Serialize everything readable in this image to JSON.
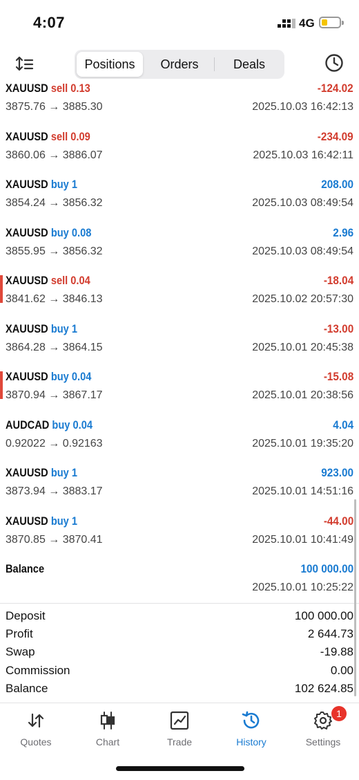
{
  "status_bar": {
    "time": "4:07",
    "network": "4G"
  },
  "header": {
    "tabs": [
      {
        "label": "Positions",
        "active": true
      },
      {
        "label": "Orders",
        "active": false
      },
      {
        "label": "Deals",
        "active": false
      }
    ]
  },
  "deals": [
    {
      "symbol": "XAUUSD",
      "side": "sell",
      "volume": "0.13",
      "prices": "3875.76 → 3885.30",
      "profit": "-124.02",
      "date": "2025.10.03 16:42:13",
      "accent": false
    },
    {
      "symbol": "XAUUSD",
      "side": "sell",
      "volume": "0.09",
      "prices": "3860.06 → 3886.07",
      "profit": "-234.09",
      "date": "2025.10.03 16:42:11",
      "accent": false
    },
    {
      "symbol": "XAUUSD",
      "side": "buy",
      "volume": "1",
      "prices": "3854.24 → 3856.32",
      "profit": "208.00",
      "date": "2025.10.03 08:49:54",
      "accent": false
    },
    {
      "symbol": "XAUUSD",
      "side": "buy",
      "volume": "0.08",
      "prices": "3855.95 → 3856.32",
      "profit": "2.96",
      "date": "2025.10.03 08:49:54",
      "accent": false
    },
    {
      "symbol": "XAUUSD",
      "side": "sell",
      "volume": "0.04",
      "prices": "3841.62 → 3846.13",
      "profit": "-18.04",
      "date": "2025.10.02 20:57:30",
      "accent": true
    },
    {
      "symbol": "XAUUSD",
      "side": "buy",
      "volume": "1",
      "prices": "3864.28 → 3864.15",
      "profit": "-13.00",
      "date": "2025.10.01 20:45:38",
      "accent": false
    },
    {
      "symbol": "XAUUSD",
      "side": "buy",
      "volume": "0.04",
      "prices": "3870.94 → 3867.17",
      "profit": "-15.08",
      "date": "2025.10.01 20:38:56",
      "accent": true
    },
    {
      "symbol": "AUDCAD",
      "side": "buy",
      "volume": "0.04",
      "prices": "0.92022 → 0.92163",
      "profit": "4.04",
      "date": "2025.10.01 19:35:20",
      "accent": false
    },
    {
      "symbol": "XAUUSD",
      "side": "buy",
      "volume": "1",
      "prices": "3873.94 → 3883.17",
      "profit": "923.00",
      "date": "2025.10.01 14:51:16",
      "accent": false
    },
    {
      "symbol": "XAUUSD",
      "side": "buy",
      "volume": "1",
      "prices": "3870.85 → 3870.41",
      "profit": "-44.00",
      "date": "2025.10.01 10:41:49",
      "accent": false
    },
    {
      "symbol": "Balance",
      "side": "",
      "volume": "",
      "prices": "",
      "profit": "100 000.00",
      "date": "2025.10.01 10:25:22",
      "accent": false
    }
  ],
  "summary": [
    {
      "label": "Deposit",
      "value": "100 000.00"
    },
    {
      "label": "Profit",
      "value": "2 644.73"
    },
    {
      "label": "Swap",
      "value": "-19.88"
    },
    {
      "label": "Commission",
      "value": "0.00"
    },
    {
      "label": "Balance",
      "value": "102 624.85"
    }
  ],
  "nav": {
    "items": [
      {
        "label": "Quotes",
        "icon": "arrows-updown-icon"
      },
      {
        "label": "Chart",
        "icon": "candlestick-icon"
      },
      {
        "label": "Trade",
        "icon": "trade-chart-icon"
      },
      {
        "label": "History",
        "icon": "history-icon",
        "active": true
      },
      {
        "label": "Settings",
        "icon": "gear-icon"
      }
    ],
    "settings_badge": "1"
  },
  "colors": {
    "sell": "#d23c2e",
    "buy": "#1a7bd1",
    "accent_bar": "#e0483a",
    "badge": "#e8332a"
  }
}
